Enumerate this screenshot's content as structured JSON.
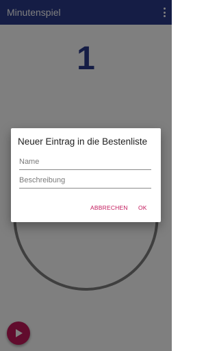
{
  "app_bar": {
    "title": "Minutenspiel",
    "overflow_icon": "more-vert-icon",
    "color": "#2a3a8a"
  },
  "main": {
    "counter": "1",
    "progress": 0.05,
    "ring_track_color": "#7f7f7f",
    "ring_progress_color": "#2a3a8a",
    "play_icon": "play-icon",
    "fab_color": "#c2185b"
  },
  "dialog": {
    "title": "Neuer Eintrag in die Bestenliste",
    "name_placeholder": "Name",
    "name_value": "",
    "description_placeholder": "Beschreibung",
    "description_value": "",
    "cancel_label": "ABBRECHEN",
    "ok_label": "OK",
    "accent": "#c2185b"
  }
}
